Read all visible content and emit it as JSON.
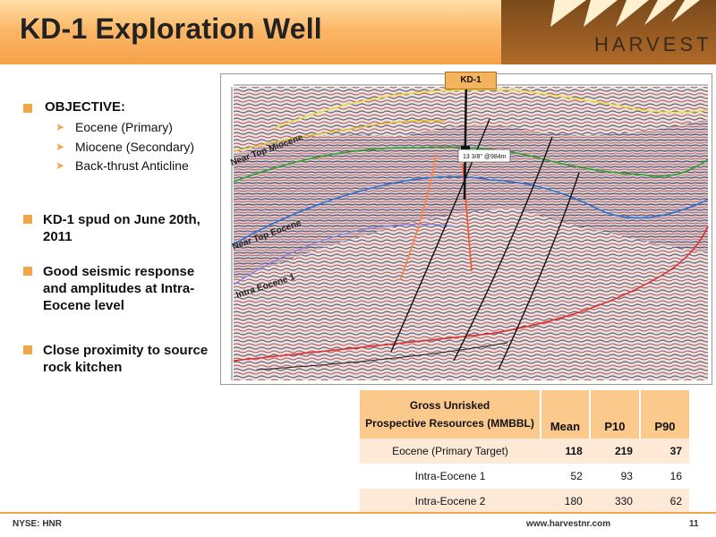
{
  "header": {
    "title": "KD-1 Exploration Well",
    "brand": "HARVEST"
  },
  "objective": {
    "heading": "OBJECTIVE:",
    "items": [
      "Eocene (Primary)",
      "Miocene (Secondary)",
      "Back-thrust Anticline"
    ]
  },
  "bullets": [
    "KD-1 spud on June 20th, 2011",
    "Good seismic response and amplitudes at Intra-Eocene level",
    "Close proximity to source rock kitchen"
  ],
  "seismic": {
    "well_label": "KD-1",
    "casing_label": "13 3/8\" @984m",
    "horizons": [
      "Near Top Miocene",
      "Near Top Eocene",
      "Intra Eocene 1"
    ]
  },
  "table": {
    "header_line1": "Gross Unrisked",
    "header_line2": "Prospective Resources (MMBBL)",
    "columns": [
      "Mean",
      "P10",
      "P90"
    ],
    "rows": [
      {
        "label": "Eocene (Primary Target)",
        "values": [
          "118",
          "219",
          "37"
        ],
        "bold": true
      },
      {
        "label": "Intra-Eocene 1",
        "values": [
          "52",
          "93",
          "16"
        ],
        "bold": false
      },
      {
        "label": "Intra-Eocene 2",
        "values": [
          "180",
          "330",
          "62"
        ],
        "bold": false
      }
    ]
  },
  "footer": {
    "left": "NYSE: HNR",
    "center": "www.harvestnr.com",
    "page": "11"
  },
  "colors": {
    "accent": "#f2a64a",
    "header_top": "#ffe0a8",
    "header_bottom": "#f6a04a",
    "table_header": "#fbc98c",
    "table_stripe": "#fde9d6"
  }
}
